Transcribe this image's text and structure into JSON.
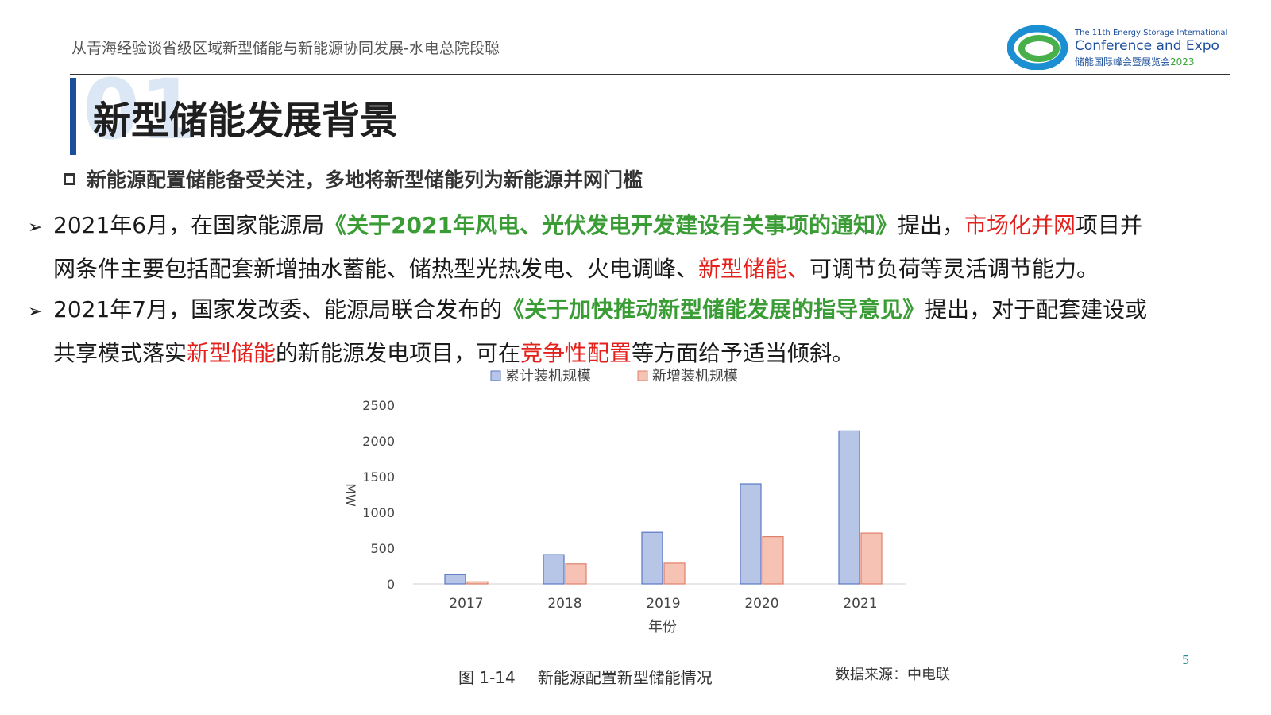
{
  "header": {
    "title": "从青海经验谈省级区域新型储能与新能源协同发展-水电总院段聪"
  },
  "logo": {
    "line1": "The 11th Energy Storage International",
    "line2": "Conference and Expo",
    "line3": "储能国际峰会暨展览会",
    "year": "2023",
    "colors": {
      "blue": "#1b4f9c",
      "green": "#3aa63a"
    }
  },
  "section": {
    "number": "01",
    "title": "新型储能发展背景"
  },
  "subheading": "新能源配置储能备受关注，多地将新型储能列为新能源并网门槛",
  "paragraphs": [
    {
      "marker": "➢",
      "p1": "2021年6月，在国家能源局",
      "doc": "《关于2021年风电、光伏发电开发建设有关事项的通知》",
      "p2": "提出，",
      "hl1": "市场化并网",
      "p3": "项目并",
      "p4": "网条件主要包括配套新增抽水蓄能、储热型光热发电、火电调峰、",
      "hl2": "新型储能、",
      "p5": "可调节负荷等灵活调节能力。"
    },
    {
      "marker": "➢",
      "p1": "2021年7月，国家发改委、能源局联合发布的",
      "doc": "《关于加快推动新型储能发展的指导意见》",
      "p2": "提出，对于配套建设或",
      "p3": "共享模式落实",
      "hl1": "新型储能",
      "p4": "的新能源发电项目，可在",
      "hl2": "竞争性配置",
      "p5": "等方面给予适当倾斜。"
    }
  ],
  "chart_caption": {
    "number": "图 1-14",
    "title": "新能源配置新型储能情况"
  },
  "source": "数据来源：中电联",
  "page_number": "5",
  "chart_data": {
    "type": "bar",
    "categories": [
      "2017",
      "2018",
      "2019",
      "2020",
      "2021"
    ],
    "series": [
      {
        "name": "累计装机规模",
        "values": [
          130,
          410,
          720,
          1400,
          2140
        ],
        "color": "#b7c5e6",
        "stroke": "#5b78c4"
      },
      {
        "name": "新增装机规模",
        "values": [
          30,
          280,
          290,
          660,
          710
        ],
        "color": "#f5c2b4",
        "stroke": "#e0806a"
      }
    ],
    "xlabel": "年份",
    "ylabel": "MW",
    "ylim": [
      0,
      2500
    ],
    "yticks": [
      0,
      500,
      1000,
      1500,
      2000,
      2500
    ],
    "legend": "top",
    "grid": false
  }
}
